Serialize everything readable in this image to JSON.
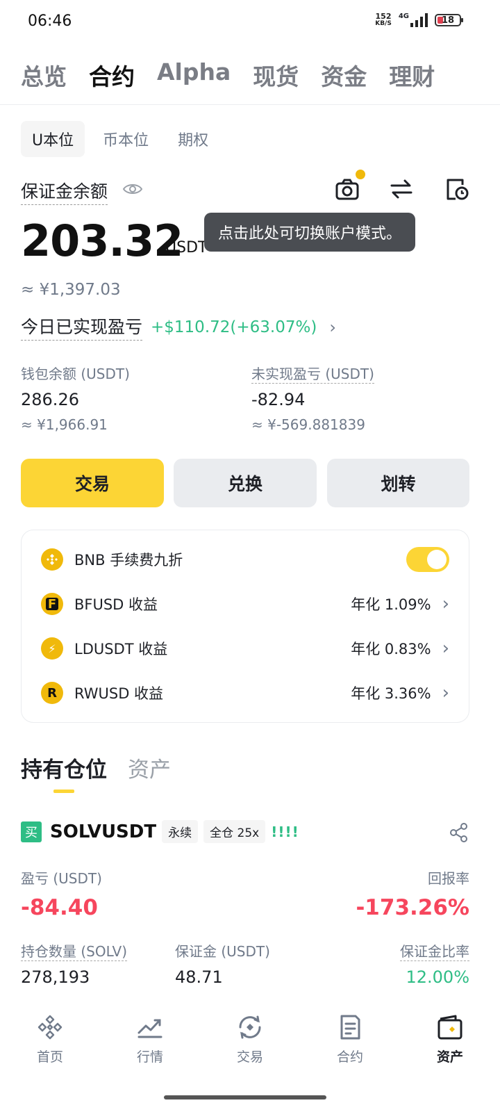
{
  "status_bar": {
    "time": "06:46",
    "net_speed_value": "152",
    "net_speed_unit": "KB/S",
    "network": "4G",
    "battery": "18"
  },
  "top_tabs": [
    "总览",
    "合约",
    "Alpha",
    "现货",
    "资金",
    "理财"
  ],
  "active_top_tab": "合约",
  "sub_tabs": [
    "U本位",
    "币本位",
    "期权"
  ],
  "active_sub_tab": "U本位",
  "margin": {
    "label": "保证金余额",
    "value": "203.32",
    "unit": "USDT",
    "approx": "≈ ¥1,397.03",
    "tooltip": "点击此处可切换账户模式。"
  },
  "today_pnl": {
    "label": "今日已实现盈亏",
    "value": "+$110.72(+63.07%)"
  },
  "wallet": {
    "label": "钱包余额 (USDT)",
    "value": "286.26",
    "approx": "≈ ¥1,966.91"
  },
  "unrealized": {
    "label": "未实现盈亏 (USDT)",
    "value": "-82.94",
    "approx": "≈ ¥-569.881839"
  },
  "actions": {
    "trade": "交易",
    "convert": "兑换",
    "transfer": "划转"
  },
  "fee_card": {
    "bnb_label": "BNB 手续费九折",
    "bnb_toggle_on": true,
    "rows": [
      {
        "name": "BFUSD 收益",
        "rate": "年化 1.09%",
        "coin": "F"
      },
      {
        "name": "LDUSDT 收益",
        "rate": "年化 0.83%",
        "coin": "⚡"
      },
      {
        "name": "RWUSD 收益",
        "rate": "年化 3.36%",
        "coin": "R"
      }
    ]
  },
  "position_tabs": [
    "持有仓位",
    "资产"
  ],
  "position": {
    "side_tag": "买",
    "symbol": "SOLVUSDT",
    "type_chip": "永续",
    "leverage_chip": "全仓 25x",
    "signal_bars": "!!!!",
    "pnl_label": "盈亏 (USDT)",
    "pnl_value": "-84.40",
    "roe_label": "回报率",
    "roe_value": "-173.26%",
    "size_label": "持仓数量 (SOLV)",
    "size_value": "278,193",
    "margin_label": "保证金 (USDT)",
    "margin_value": "48.71",
    "margin_ratio_label": "保证金比率",
    "margin_ratio_value": "12.00%"
  },
  "bottom_nav": [
    {
      "label": "首页",
      "icon": "home-icon"
    },
    {
      "label": "行情",
      "icon": "markets-icon"
    },
    {
      "label": "交易",
      "icon": "trade-icon"
    },
    {
      "label": "合约",
      "icon": "futures-icon"
    },
    {
      "label": "资产",
      "icon": "wallet-icon"
    }
  ],
  "colors": {
    "accent": "#fcd535",
    "up": "#2ebd85",
    "down": "#f6465d"
  }
}
